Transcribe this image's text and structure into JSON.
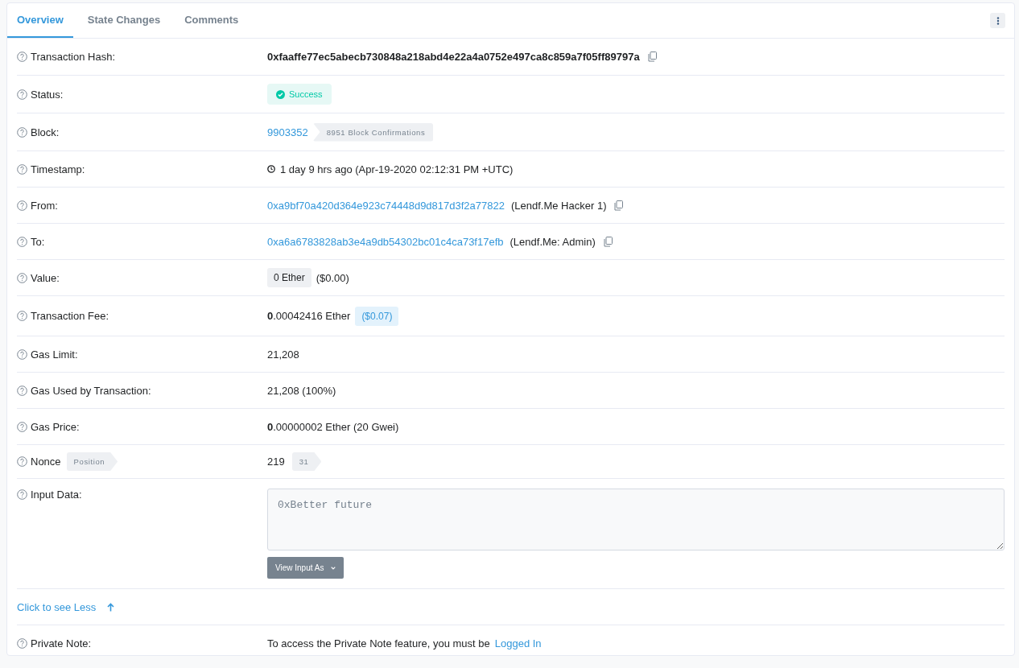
{
  "tabs": [
    {
      "label": "Overview",
      "selected": true
    },
    {
      "label": "State Changes",
      "selected": false
    },
    {
      "label": "Comments",
      "selected": false
    }
  ],
  "rows": [
    {
      "kind": "hash",
      "label": "Transaction Hash:",
      "value": "0xfaaffe77ec5abecb730848a218abd4e22a4a0752e497ca8c859a7f05ff89797a"
    },
    {
      "kind": "status",
      "label": "Status:",
      "value": "Success"
    },
    {
      "kind": "block",
      "label": "Block:",
      "value": "9903352",
      "badge": "8951 Block Confirmations"
    },
    {
      "kind": "timestamp",
      "label": "Timestamp:",
      "value": "1 day 9 hrs ago (Apr-19-2020 02:12:31 PM +UTC)"
    },
    {
      "kind": "address",
      "label": "From:",
      "address": "0xa9bf70a420d364e923c74448d9d817d3f2a77822",
      "tag": "(Lendf.Me Hacker 1)"
    },
    {
      "kind": "address",
      "label": "To:",
      "address": "0xa6a6783828ab3e4a9db54302bc01c4ca73f17efb",
      "tag": "(Lendf.Me: Admin)"
    },
    {
      "kind": "value",
      "label": "Value:",
      "amount": "0 Ether",
      "usd": "($0.00)"
    },
    {
      "kind": "fee",
      "label": "Transaction Fee:",
      "amount": "**0**.00042416 Ether",
      "usd": "($0.07)"
    },
    {
      "kind": "text",
      "label": "Gas Limit:",
      "value": "21,208"
    },
    {
      "kind": "text",
      "label": "Gas Used by Transaction:",
      "value": "21,208 (100%)"
    },
    {
      "kind": "text",
      "label": "Gas Price:",
      "value": "**0**.00000002 Ether (20 Gwei)"
    },
    {
      "kind": "nonce",
      "label": "Nonce",
      "label_badge": "Position",
      "value": "219",
      "badge": "31"
    },
    {
      "kind": "input",
      "label": "Input Data:",
      "value": "0xBetter future",
      "button": "View Input As"
    }
  ],
  "collapse_link": "Click to see Less",
  "private_note": {
    "label": "Private Note:",
    "text": "To access the Private Note feature, you must be",
    "link": "Logged In"
  }
}
